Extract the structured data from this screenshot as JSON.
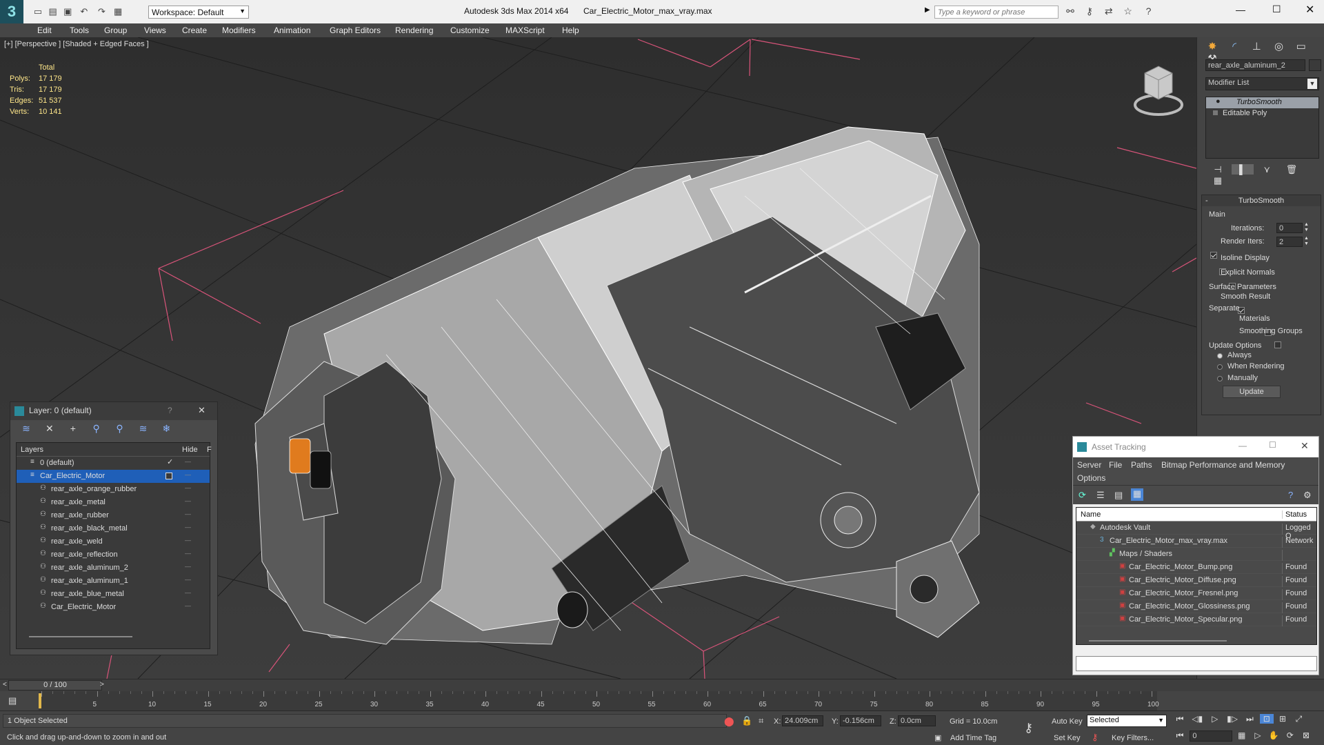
{
  "title": {
    "app": "Autodesk 3ds Max  2014 x64",
    "file": "Car_Electric_Motor_max_vray.max",
    "workspace": "Workspace: Default",
    "search_placeholder": "Type a keyword or phrase"
  },
  "menu": [
    "Edit",
    "Tools",
    "Group",
    "Views",
    "Create",
    "Modifiers",
    "Animation",
    "Graph Editors",
    "Rendering",
    "Customize",
    "MAXScript",
    "Help"
  ],
  "viewport": {
    "label": "[+] [Perspective ] [Shaded + Edged Faces ]",
    "stats": {
      "header": "Total",
      "rows": [
        {
          "k": "Polys:",
          "v": "17 179"
        },
        {
          "k": "Tris:",
          "v": "17 179"
        },
        {
          "k": "Edges:",
          "v": "51 537"
        },
        {
          "k": "Verts:",
          "v": "10 141"
        }
      ]
    }
  },
  "command_panel": {
    "object_name": "rear_axle_aluminum_2",
    "modifier_list": "Modifier List",
    "stack": [
      "TurboSmooth",
      "Editable Poly"
    ],
    "rollout_title": "TurboSmooth",
    "main_label": "Main",
    "iterations_label": "Iterations:",
    "iterations": "0",
    "render_iters_label": "Render Iters:",
    "render_iters": "2",
    "isoline": "Isoline Display",
    "explicit_normals": "Explicit Normals",
    "surface_params": "Surface Parameters",
    "smooth_result": "Smooth Result",
    "separate": "Separate",
    "materials": "Materials",
    "smoothing_groups": "Smoothing Groups",
    "update_options": "Update Options",
    "always": "Always",
    "when_rendering": "When Rendering",
    "manually": "Manually",
    "update_btn": "Update"
  },
  "layer_dialog": {
    "title": "Layer: 0 (default)",
    "help": "?",
    "col_layers": "Layers",
    "col_hide": "Hide",
    "col_f": "F",
    "rows": [
      {
        "name": "0 (default)",
        "level": 0
      },
      {
        "name": "Car_Electric_Motor",
        "level": 0
      },
      {
        "name": "rear_axle_orange_rubber",
        "level": 1
      },
      {
        "name": "rear_axle_metal",
        "level": 1
      },
      {
        "name": "rear_axle_rubber",
        "level": 1
      },
      {
        "name": "rear_axle_black_metal",
        "level": 1
      },
      {
        "name": "rear_axle_weld",
        "level": 1
      },
      {
        "name": "rear_axle_reflection",
        "level": 1
      },
      {
        "name": "rear_axle_aluminum_2",
        "level": 1
      },
      {
        "name": "rear_axle_aluminum_1",
        "level": 1
      },
      {
        "name": "rear_axle_blue_metal",
        "level": 1
      },
      {
        "name": "Car_Electric_Motor",
        "level": 1
      }
    ]
  },
  "asset_tracking": {
    "title": "Asset Tracking",
    "menu": [
      "Server",
      "File",
      "Paths",
      "Bitmap Performance and Memory"
    ],
    "options": "Options",
    "col_name": "Name",
    "col_status": "Status",
    "rows": [
      {
        "name": "Autodesk Vault",
        "status": "Logged O",
        "level": 0
      },
      {
        "name": "Car_Electric_Motor_max_vray.max",
        "status": "Network",
        "level": 1
      },
      {
        "name": "Maps / Shaders",
        "status": "",
        "level": 2
      },
      {
        "name": "Car_Electric_Motor_Bump.png",
        "status": "Found",
        "level": 3
      },
      {
        "name": "Car_Electric_Motor_Diffuse.png",
        "status": "Found",
        "level": 3
      },
      {
        "name": "Car_Electric_Motor_Fresnel.png",
        "status": "Found",
        "level": 3
      },
      {
        "name": "Car_Electric_Motor_Glossiness.png",
        "status": "Found",
        "level": 3
      },
      {
        "name": "Car_Electric_Motor_Specular.png",
        "status": "Found",
        "level": 3
      }
    ]
  },
  "timeline": {
    "frame": "0 / 100",
    "ticks": [
      "0",
      "5",
      "10",
      "15",
      "20",
      "25",
      "30",
      "35",
      "40",
      "45",
      "50",
      "55",
      "60",
      "65",
      "70",
      "75",
      "80",
      "85",
      "90",
      "95",
      "100"
    ]
  },
  "status": {
    "selected": "1 Object Selected",
    "prompt": "Click and drag up-and-down to zoom in and out",
    "x_label": "X:",
    "x": "24.009cm",
    "y_label": "Y:",
    "y": "-0.156cm",
    "z_label": "Z:",
    "z": "0.0cm",
    "grid": "Grid = 10.0cm",
    "add_time_tag": "Add Time Tag",
    "auto_key": "Auto Key",
    "set_key": "Set Key",
    "selected_dd": "Selected",
    "key_filters": "Key Filters...",
    "frame_input": "0"
  }
}
